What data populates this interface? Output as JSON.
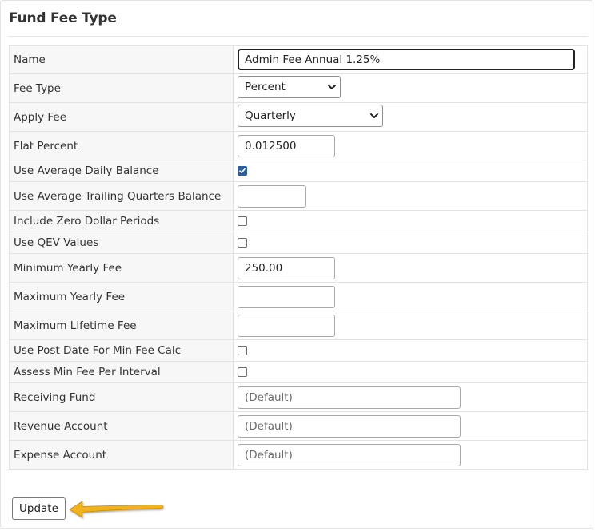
{
  "panel": {
    "title": "Fund Fee Type"
  },
  "fields": {
    "name": {
      "label": "Name",
      "value": "Admin Fee Annual 1.25%"
    },
    "fee_type": {
      "label": "Fee Type",
      "value": "Percent"
    },
    "apply_fee": {
      "label": "Apply Fee",
      "value": "Quarterly"
    },
    "flat_percent": {
      "label": "Flat Percent",
      "value": "0.012500"
    },
    "use_average_daily_balance": {
      "label": "Use Average Daily Balance",
      "checked": true
    },
    "use_average_trailing_quarters_balance": {
      "label": "Use Average Trailing Quarters Balance",
      "value": ""
    },
    "include_zero_dollar_periods": {
      "label": "Include Zero Dollar Periods",
      "checked": false
    },
    "use_qev_values": {
      "label": "Use QEV Values",
      "checked": false
    },
    "minimum_yearly_fee": {
      "label": "Minimum Yearly Fee",
      "value": "250.00"
    },
    "maximum_yearly_fee": {
      "label": "Maximum Yearly Fee",
      "value": ""
    },
    "maximum_lifetime_fee": {
      "label": "Maximum Lifetime Fee",
      "value": ""
    },
    "use_post_date_for_min_fee_calc": {
      "label": "Use Post Date For Min Fee Calc",
      "checked": false
    },
    "assess_min_fee_per_interval": {
      "label": "Assess Min Fee Per Interval",
      "checked": false
    },
    "receiving_fund": {
      "label": "Receiving Fund",
      "placeholder": "(Default)"
    },
    "revenue_account": {
      "label": "Revenue Account",
      "placeholder": "(Default)"
    },
    "expense_account": {
      "label": "Expense Account",
      "placeholder": "(Default)"
    }
  },
  "actions": {
    "update_label": "Update"
  },
  "colors": {
    "checkbox_checked": "#2c5c9c",
    "pointer_arrow": "#f2b21b",
    "label_background": "#f7f7f7"
  }
}
